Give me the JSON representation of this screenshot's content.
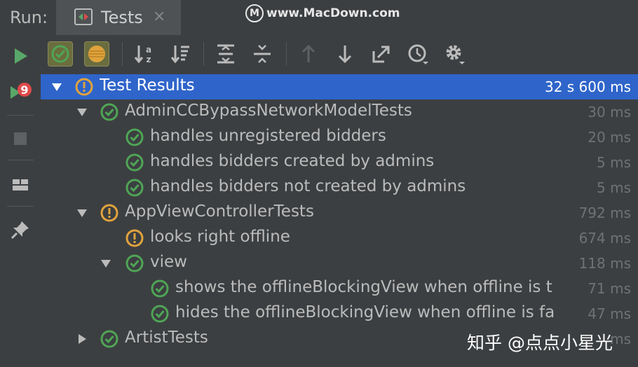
{
  "header": {
    "run_label": "Run:",
    "tab_title": "Tests",
    "tab_close": "×",
    "watermark_logo": "M",
    "watermark": "www.MacDown.com"
  },
  "left_toolbar": [
    "rerun-icon",
    "rerun-failed-icon",
    "stop-icon",
    "layout-icon",
    "pin-icon"
  ],
  "top_toolbar": [
    "show-passed-icon",
    "show-ignored-icon",
    "sort-alpha-icon",
    "sort-duration-icon",
    "expand-all-icon",
    "collapse-all-icon",
    "prev-failed-icon",
    "next-failed-icon",
    "export-icon",
    "history-icon",
    "settings-icon"
  ],
  "colors": {
    "pass": "#4fa556",
    "warn": "#e0a33d",
    "selection": "#2f65ca",
    "run": "#59a869",
    "fail_badge": "#e04a4a"
  },
  "tree": {
    "rows": [
      {
        "name": "Test Results",
        "time": "32 s 600 ms",
        "status": "warn",
        "expanded": true
      },
      {
        "name": "AdminCCBypassNetworkModelTests",
        "time": "30 ms",
        "status": "pass",
        "expanded": true
      },
      {
        "name": "handles unregistered bidders",
        "time": "20 ms",
        "status": "pass"
      },
      {
        "name": "handles bidders created by admins",
        "time": "5 ms",
        "status": "pass"
      },
      {
        "name": "handles bidders not created by admins",
        "time": "5 ms",
        "status": "pass"
      },
      {
        "name": "AppViewControllerTests",
        "time": "792 ms",
        "status": "warn",
        "expanded": true
      },
      {
        "name": "looks right offline",
        "time": "674 ms",
        "status": "warn"
      },
      {
        "name": "view",
        "time": "118 ms",
        "status": "pass",
        "expanded": true
      },
      {
        "name": "shows the offlineBlockingView when offline is t",
        "time": "71 ms",
        "status": "pass"
      },
      {
        "name": "hides the offlineBlockingView when offline is fa",
        "time": "47 ms",
        "status": "pass"
      },
      {
        "name": "ArtistTests",
        "time": "ms",
        "status": "pass",
        "expanded": false
      }
    ]
  },
  "footer_watermark": "知乎 @点点小星光"
}
